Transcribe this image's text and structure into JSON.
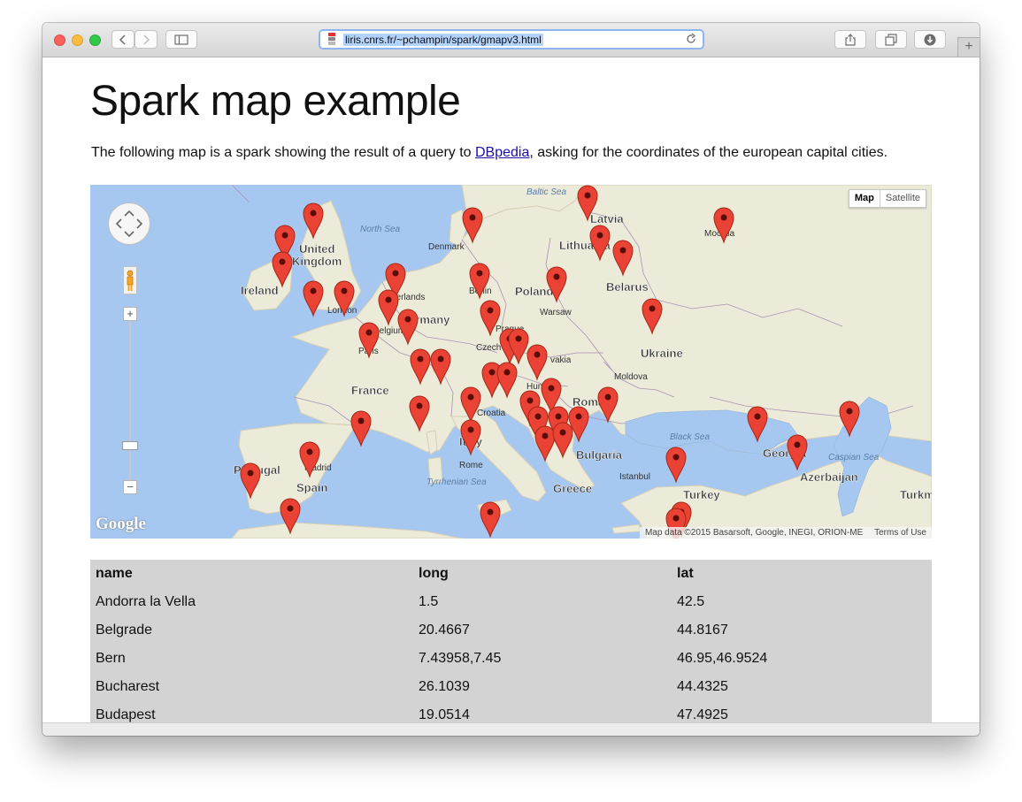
{
  "browser": {
    "url": "liris.cnrs.fr/~pchampin/spark/gmapv3.html",
    "new_tab_label": "+"
  },
  "page": {
    "title": "Spark map example",
    "intro_before": "The following map is a spark showing the result of a query to ",
    "intro_link": "DBpedia",
    "intro_after": ", asking for the coordinates of the european capital cities."
  },
  "map": {
    "type_buttons": {
      "map": "Map",
      "satellite": "Satellite"
    },
    "zoom_in": "+",
    "zoom_out": "−",
    "logo": "Google",
    "attribution": "Map data ©2015 Basarsoft, Google, INEGI, ORION-ME",
    "terms": "Terms of Use",
    "colors": {
      "water": "#a6c8f0",
      "land": "#ecead9",
      "marker": "#ea4335"
    },
    "labels": [
      {
        "text": "Baltic Sea",
        "kind": "sea"
      },
      {
        "text": "Latvia",
        "kind": "country"
      },
      {
        "text": "North Sea",
        "kind": "sea"
      },
      {
        "text": "Denmark",
        "kind": "city"
      },
      {
        "text": "Москва",
        "kind": "city"
      },
      {
        "text": "Lithuania",
        "kind": "country"
      },
      {
        "text": "United",
        "kind": "country"
      },
      {
        "text": "Kingdom",
        "kind": "country"
      },
      {
        "text": "Ireland",
        "kind": "country"
      },
      {
        "text": "Berlin",
        "kind": "city"
      },
      {
        "text": "Poland",
        "kind": "country"
      },
      {
        "text": "Belarus",
        "kind": "country"
      },
      {
        "text": "herlands",
        "kind": "city"
      },
      {
        "text": "London",
        "kind": "city"
      },
      {
        "text": "Warsaw",
        "kind": "city"
      },
      {
        "text": "Germany",
        "kind": "country"
      },
      {
        "text": "Prague",
        "kind": "city"
      },
      {
        "text": "Belgium",
        "kind": "city"
      },
      {
        "text": "Czech",
        "kind": "city"
      },
      {
        "text": "Paris",
        "kind": "city"
      },
      {
        "text": "Ukraine",
        "kind": "country"
      },
      {
        "text": "vakia",
        "kind": "city"
      },
      {
        "text": "Moldova",
        "kind": "city"
      },
      {
        "text": "France",
        "kind": "country"
      },
      {
        "text": "Hun",
        "kind": "city"
      },
      {
        "text": "Roma",
        "kind": "country"
      },
      {
        "text": "Croatia",
        "kind": "city"
      },
      {
        "text": "Black Sea",
        "kind": "sea"
      },
      {
        "text": "Italy",
        "kind": "country"
      },
      {
        "text": "Bulgaria",
        "kind": "country"
      },
      {
        "text": "Georgia",
        "kind": "country"
      },
      {
        "text": "Caspian Sea",
        "kind": "sea"
      },
      {
        "text": "Portugal",
        "kind": "country"
      },
      {
        "text": "Madrid",
        "kind": "city"
      },
      {
        "text": "Rome",
        "kind": "city"
      },
      {
        "text": "Istanbul",
        "kind": "city"
      },
      {
        "text": "Azerbaijan",
        "kind": "country"
      },
      {
        "text": "Spain",
        "kind": "country"
      },
      {
        "text": "Tyrrhenian Sea",
        "kind": "sea"
      },
      {
        "text": "Greece",
        "kind": "country"
      },
      {
        "text": "Turkey",
        "kind": "country"
      },
      {
        "text": "Turkm",
        "kind": "country"
      }
    ]
  },
  "table": {
    "headers": [
      "name",
      "long",
      "lat"
    ],
    "rows": [
      [
        "Andorra la Vella",
        "1.5",
        "42.5"
      ],
      [
        "Belgrade",
        "20.4667",
        "44.8167"
      ],
      [
        "Bern",
        "7.43958,7.45",
        "46.95,46.9524"
      ],
      [
        "Bucharest",
        "26.1039",
        "44.4325"
      ],
      [
        "Budapest",
        "19.0514",
        "47.4925"
      ]
    ]
  }
}
